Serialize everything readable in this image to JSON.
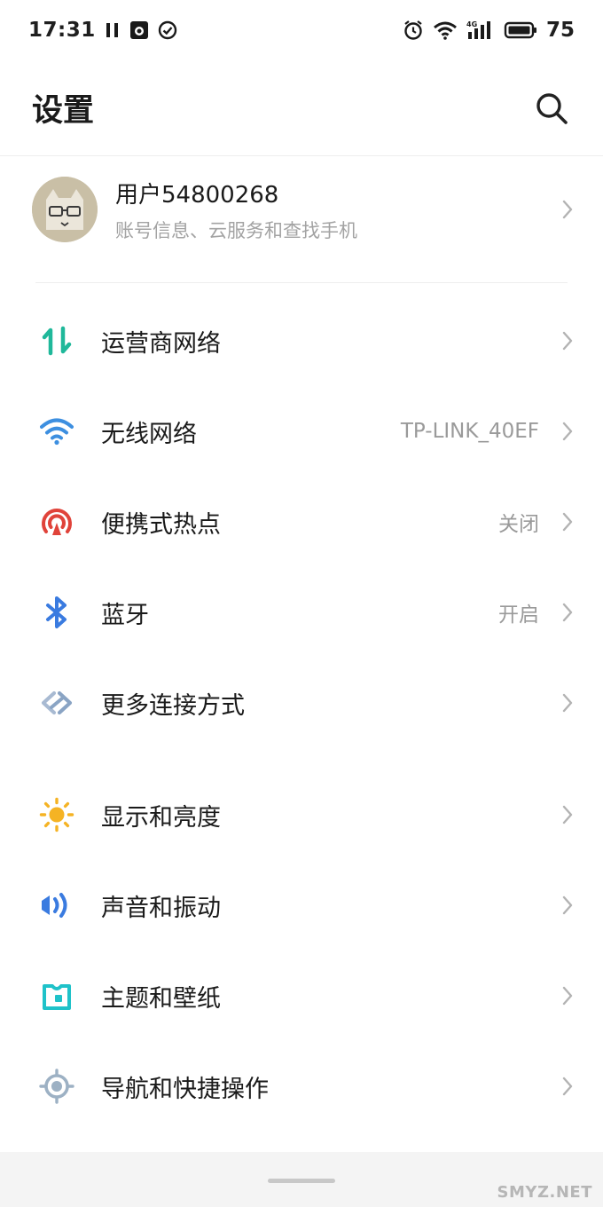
{
  "status_bar": {
    "time": "17:31",
    "battery_level": "75",
    "network_badge": "4G",
    "left_icons": [
      "pause-icon",
      "app-notification-icon",
      "check-circle-icon"
    ],
    "right_icons": [
      "alarm-icon",
      "wifi-icon",
      "signal-icon",
      "battery-icon"
    ]
  },
  "header": {
    "title": "设置",
    "search_icon": "search-icon"
  },
  "account": {
    "name": "用户54800268",
    "subtitle": "账号信息、云服务和查找手机"
  },
  "groups": [
    {
      "items": [
        {
          "label": "运营商网络",
          "value": "",
          "icon": "mobile-data-icon",
          "color": "#1fb89a"
        },
        {
          "label": "无线网络",
          "value": "TP-LINK_40EF",
          "icon": "wifi-icon",
          "color": "#3d8fe0"
        },
        {
          "label": "便携式热点",
          "value": "关闭",
          "icon": "hotspot-icon",
          "color": "#e0433a"
        },
        {
          "label": "蓝牙",
          "value": "开启",
          "icon": "bluetooth-icon",
          "color": "#3a7be0"
        },
        {
          "label": "更多连接方式",
          "value": "",
          "icon": "link-icon",
          "color": "#8aa4c4"
        }
      ]
    },
    {
      "items": [
        {
          "label": "显示和亮度",
          "value": "",
          "icon": "brightness-icon",
          "color": "#f5b324"
        },
        {
          "label": "声音和振动",
          "value": "",
          "icon": "sound-icon",
          "color": "#3a7be0"
        },
        {
          "label": "主题和壁纸",
          "value": "",
          "icon": "theme-icon",
          "color": "#1fc2c9"
        },
        {
          "label": "导航和快捷操作",
          "value": "",
          "icon": "navigation-icon",
          "color": "#9db1c4"
        }
      ]
    }
  ],
  "watermark": "SMYZ.NET"
}
